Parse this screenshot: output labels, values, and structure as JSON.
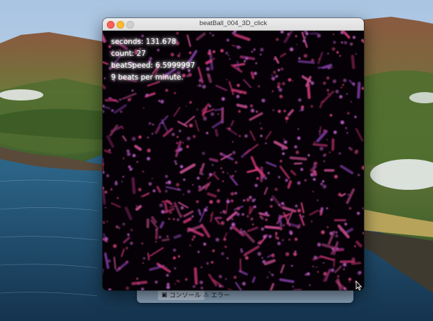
{
  "window": {
    "title": "beatBall_004_3D_click",
    "controls": [
      "close",
      "minimize",
      "maximize"
    ]
  },
  "hud": {
    "seconds": "seconds: 131.678",
    "count": "count: 27",
    "beat_speed": "beatSpeed: 6.5999997",
    "beats_per_minute": "9 beats per minute."
  },
  "console": {
    "tabs": [
      {
        "label": "コンソール",
        "icon": "terminal-icon",
        "active": true
      },
      {
        "label": "エラー",
        "icon": "warning-icon",
        "active": false
      }
    ]
  },
  "colors": {
    "canvas_bg": "#050106",
    "particle_pink": "#d23a7a",
    "particle_purple": "#7a3a9e",
    "hud_text": "#ffffff"
  },
  "desktop": {
    "wallpaper": "coastal-mountains-wallpaper"
  }
}
